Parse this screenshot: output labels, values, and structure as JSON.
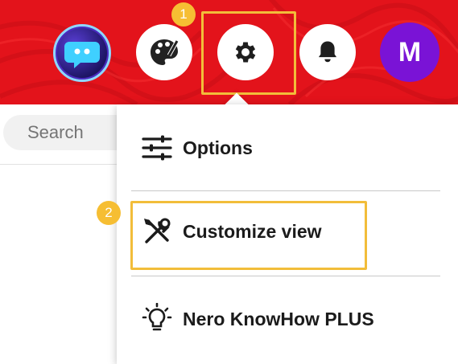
{
  "header": {
    "background_color": "#e3131b",
    "buttons": [
      {
        "name": "assistant",
        "icon": "robot-chat-icon"
      },
      {
        "name": "themes",
        "icon": "palette-icon"
      },
      {
        "name": "settings",
        "icon": "gear-icon"
      },
      {
        "name": "notifications",
        "icon": "bell-icon"
      }
    ],
    "user_avatar": {
      "initial": "M",
      "color": "#7a13d6"
    }
  },
  "search": {
    "placeholder": "Search"
  },
  "callouts": [
    {
      "label": "1",
      "color": "#f6be33"
    },
    {
      "label": "2",
      "color": "#f6be33"
    }
  ],
  "settings_menu": {
    "items": [
      {
        "label": "Options",
        "icon": "sliders-icon"
      },
      {
        "label": "Customize view",
        "icon": "tools-icon"
      },
      {
        "label": "Nero KnowHow PLUS",
        "icon": "lightbulb-icon"
      }
    ]
  },
  "highlight_color": "#f2bd3a"
}
